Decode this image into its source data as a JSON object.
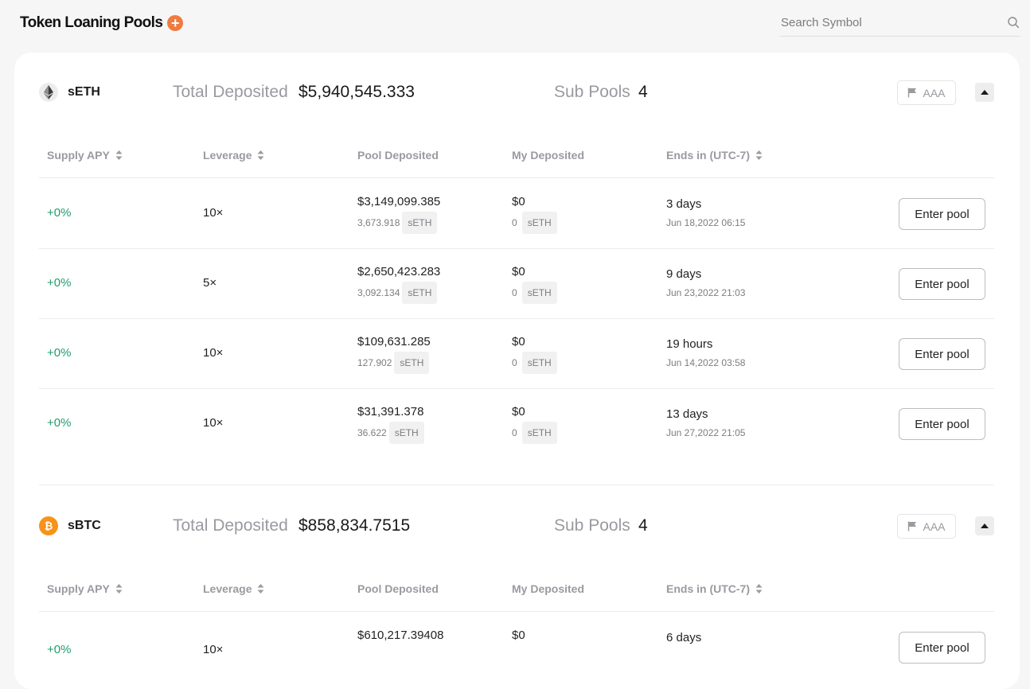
{
  "header": {
    "title": "Token Loaning Pools",
    "add_icon": "plus-circle-icon",
    "search_placeholder": "Search Symbol"
  },
  "colors": {
    "accent": "#f07b3f",
    "positive": "#1f9d6c",
    "muted": "#9a9aa0"
  },
  "table_headers": {
    "supply_apy": "Supply APY",
    "leverage": "Leverage",
    "pool_deposited": "Pool Deposited",
    "my_deposited": "My Deposited",
    "ends_in": "Ends in (UTC-7)"
  },
  "pools": [
    {
      "token": "sETH",
      "icon": "ethereum-icon",
      "total_deposited_label": "Total Deposited",
      "total_deposited": "$5,940,545.333",
      "sub_pools_label": "Sub Pools",
      "sub_pools": "4",
      "rating": "AAA",
      "rows": [
        {
          "apy": "+0%",
          "leverage": "10×",
          "pool_usd": "$3,149,099.385",
          "pool_amount": "3,673.918",
          "pool_unit": "sETH",
          "my_usd": "$0",
          "my_amount": "0",
          "my_unit": "sETH",
          "ends_rel": "3 days",
          "ends_abs": "Jun 18,2022 06:15",
          "button": "Enter pool"
        },
        {
          "apy": "+0%",
          "leverage": "5×",
          "pool_usd": "$2,650,423.283",
          "pool_amount": "3,092.134",
          "pool_unit": "sETH",
          "my_usd": "$0",
          "my_amount": "0",
          "my_unit": "sETH",
          "ends_rel": "9 days",
          "ends_abs": "Jun 23,2022 21:03",
          "button": "Enter pool"
        },
        {
          "apy": "+0%",
          "leverage": "10×",
          "pool_usd": "$109,631.285",
          "pool_amount": "127.902",
          "pool_unit": "sETH",
          "my_usd": "$0",
          "my_amount": "0",
          "my_unit": "sETH",
          "ends_rel": "19 hours",
          "ends_abs": "Jun 14,2022 03:58",
          "button": "Enter pool"
        },
        {
          "apy": "+0%",
          "leverage": "10×",
          "pool_usd": "$31,391.378",
          "pool_amount": "36.622",
          "pool_unit": "sETH",
          "my_usd": "$0",
          "my_amount": "0",
          "my_unit": "sETH",
          "ends_rel": "13 days",
          "ends_abs": "Jun 27,2022 21:05",
          "button": "Enter pool"
        }
      ]
    },
    {
      "token": "sBTC",
      "icon": "bitcoin-icon",
      "total_deposited_label": "Total Deposited",
      "total_deposited": "$858,834.7515",
      "sub_pools_label": "Sub Pools",
      "sub_pools": "4",
      "rating": "AAA",
      "rows": [
        {
          "apy": "+0%",
          "leverage": "10×",
          "pool_usd": "$610,217.39408",
          "my_usd": "$0",
          "ends_rel": "6 days",
          "button": "Enter pool"
        }
      ]
    }
  ]
}
